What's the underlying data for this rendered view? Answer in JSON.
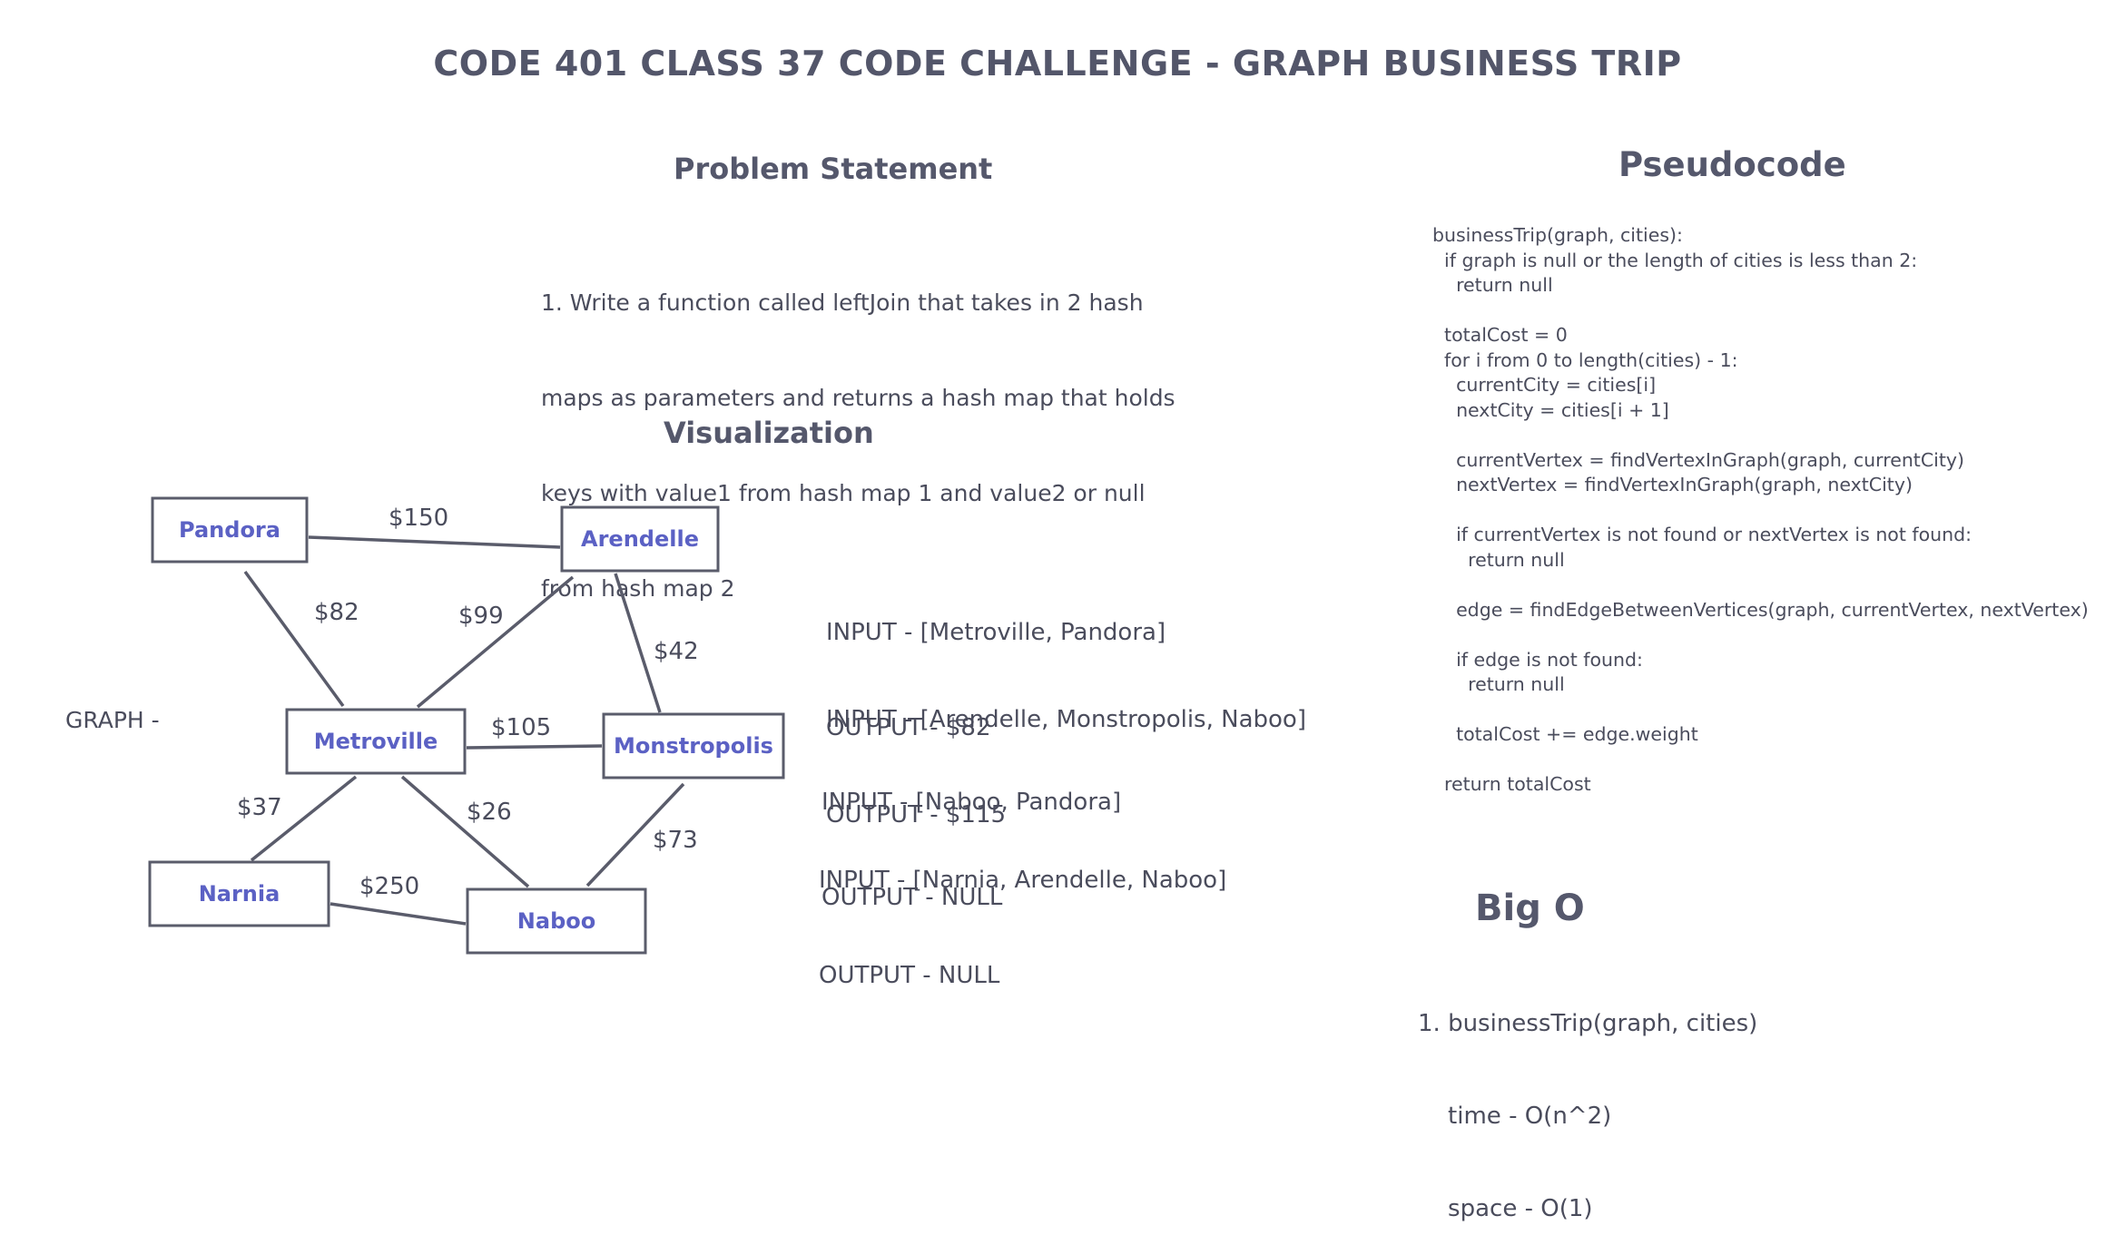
{
  "title": "CODE 401 CLASS 37 CODE CHALLENGE - GRAPH BUSINESS TRIP",
  "problem": {
    "heading": "Problem Statement",
    "lines": [
      "1. Write a function called leftJoin that takes in 2 hash",
      "maps as parameters and returns a hash map that holds",
      "keys with value1 from hash map 1 and value2 or null",
      "from hash map 2"
    ]
  },
  "visualization": {
    "heading": "Visualization",
    "graph_label": "GRAPH -",
    "nodes": [
      {
        "id": "pandora",
        "label": "Pandora"
      },
      {
        "id": "arendelle",
        "label": "Arendelle"
      },
      {
        "id": "metroville",
        "label": "Metroville"
      },
      {
        "id": "monstropolis",
        "label": "Monstropolis"
      },
      {
        "id": "narnia",
        "label": "Narnia"
      },
      {
        "id": "naboo",
        "label": "Naboo"
      }
    ],
    "edges": [
      {
        "from": "pandora",
        "to": "arendelle",
        "weight": "$150"
      },
      {
        "from": "pandora",
        "to": "metroville",
        "weight": "$82"
      },
      {
        "from": "arendelle",
        "to": "metroville",
        "weight": "$99"
      },
      {
        "from": "arendelle",
        "to": "monstropolis",
        "weight": "$42"
      },
      {
        "from": "metroville",
        "to": "monstropolis",
        "weight": "$105"
      },
      {
        "from": "metroville",
        "to": "narnia",
        "weight": "$37"
      },
      {
        "from": "metroville",
        "to": "naboo",
        "weight": "$26"
      },
      {
        "from": "monstropolis",
        "to": "naboo",
        "weight": "$73"
      },
      {
        "from": "narnia",
        "to": "naboo",
        "weight": "$250"
      }
    ],
    "examples": [
      {
        "input": "INPUT - [Metroville, Pandora]",
        "output": "OUTPUT - $82"
      },
      {
        "input": "INPUT - [Arendelle, Monstropolis, Naboo]",
        "output": "OUTPUT - $115"
      },
      {
        "input": "INPUT - [Naboo, Pandora]",
        "output": "OUTPUT - NULL"
      },
      {
        "input": "INPUT - [Narnia, Arendelle, Naboo]",
        "output": "OUTPUT - NULL"
      }
    ]
  },
  "pseudocode": {
    "heading": "Pseudocode",
    "code": "businessTrip(graph, cities):\n  if graph is null or the length of cities is less than 2:\n    return null\n\n  totalCost = 0\n  for i from 0 to length(cities) - 1:\n    currentCity = cities[i]\n    nextCity = cities[i + 1]\n\n    currentVertex = findVertexInGraph(graph, currentCity)\n    nextVertex = findVertexInGraph(graph, nextCity)\n\n    if currentVertex is not found or nextVertex is not found:\n      return null\n\n    edge = findEdgeBetweenVertices(graph, currentVertex, nextVertex)\n\n    if edge is not found:\n      return null\n\n    totalCost += edge.weight\n\n  return totalCost"
  },
  "big_o": {
    "heading": "Big O",
    "lines": [
      "1. businessTrip(graph, cities)",
      "    time - O(n^2)",
      "    space - O(1)"
    ]
  }
}
